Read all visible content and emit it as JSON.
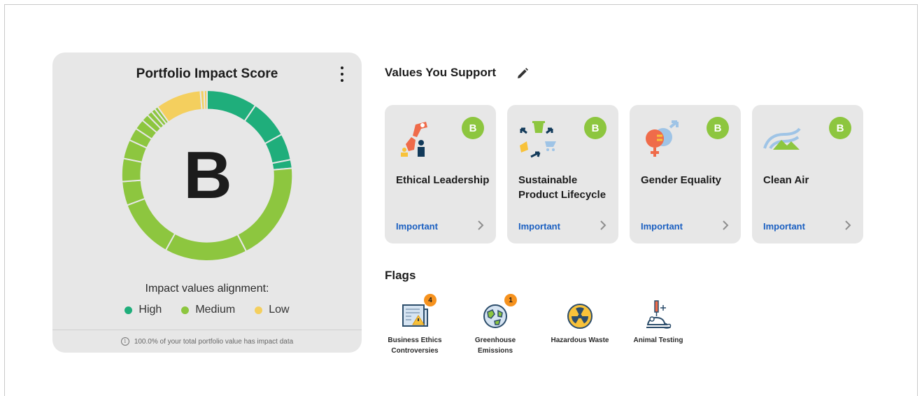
{
  "score_card": {
    "title": "Portfolio Impact Score",
    "grade": "B",
    "alignment_label": "Impact values alignment:",
    "legend": [
      {
        "label": "High",
        "color": "#1fae7b"
      },
      {
        "label": "Medium",
        "color": "#8dc63f"
      },
      {
        "label": "Low",
        "color": "#f4cf5e"
      }
    ],
    "footer_text": "100.0% of your total portfolio value has impact data",
    "icons": {
      "menu": "kebab-menu-icon",
      "info": "info-icon"
    }
  },
  "values_section": {
    "title": "Values You Support",
    "edit_icon": "pencil-icon",
    "cards": [
      {
        "name": "Ethical Leadership",
        "grade": "B",
        "importance": "Important",
        "icon": "ethical-leadership-icon"
      },
      {
        "name": "Sustainable Product Lifecycle",
        "grade": "B",
        "importance": "Important",
        "icon": "recycle-lifecycle-icon"
      },
      {
        "name": "Gender Equality",
        "grade": "B",
        "importance": "Important",
        "icon": "gender-equality-icon"
      },
      {
        "name": "Clean Air",
        "grade": "B",
        "importance": "Important",
        "icon": "clean-air-icon"
      }
    ]
  },
  "flags_section": {
    "title": "Flags",
    "flags": [
      {
        "label": "Business Ethics Controversies",
        "count": "4",
        "icon": "newspaper-warning-icon"
      },
      {
        "label": "Greenhouse Emissions",
        "count": "1",
        "icon": "globe-icon"
      },
      {
        "label": "Hazardous Waste",
        "count": "",
        "icon": "radioactive-icon"
      },
      {
        "label": "Animal Testing",
        "count": "",
        "icon": "lab-mouse-icon"
      }
    ]
  },
  "colors": {
    "high": "#1fae7b",
    "medium": "#8dc63f",
    "low": "#f4cf5e",
    "link": "#1a5fc1",
    "flag_badge": "#f6921e",
    "card_bg": "#e7e7e7"
  }
}
